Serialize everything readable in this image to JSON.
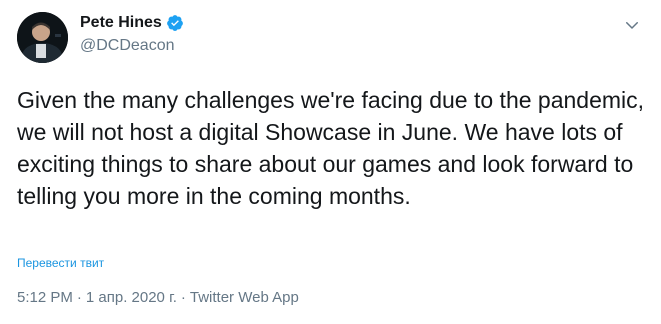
{
  "tweet": {
    "author_name": "Pete Hines",
    "handle": "@DCDeacon",
    "text": "Given the many challenges we're facing due to the pandemic, we will not host a digital Showcase in June. We have lots of exciting things to share about our games and look forward to telling you more in the coming months.",
    "translate_label": "Перевести твит",
    "time": "5:12 PM",
    "date": "1 апр. 2020 г.",
    "source": "Twitter Web App",
    "separator": "·"
  },
  "icons": {
    "verified": "verified-badge-icon",
    "menu": "chevron-down-icon"
  },
  "colors": {
    "link": "#1b95e0",
    "verified": "#1da1f2",
    "secondary_text": "#657786",
    "primary_text": "#14171a"
  }
}
